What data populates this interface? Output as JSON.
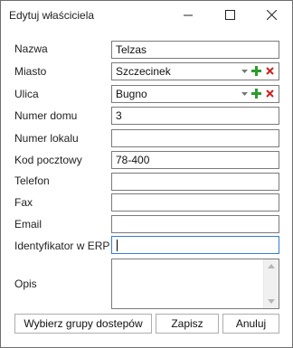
{
  "window": {
    "title": "Edytuj właściciela"
  },
  "fields": {
    "nazwa": {
      "label": "Nazwa",
      "value": "Telzas"
    },
    "miasto": {
      "label": "Miasto",
      "value": "Szczecinek"
    },
    "ulica": {
      "label": "Ulica",
      "value": "Bugno"
    },
    "numer_domu": {
      "label": "Numer domu",
      "value": "3"
    },
    "numer_lokalu": {
      "label": "Numer lokalu",
      "value": ""
    },
    "kod_pocztowy": {
      "label": "Kod pocztowy",
      "value": "78-400"
    },
    "telefon": {
      "label": "Telefon",
      "value": ""
    },
    "fax": {
      "label": "Fax",
      "value": ""
    },
    "email": {
      "label": "Email",
      "value": ""
    },
    "identyfikator_erp": {
      "label": "Identyfikator w ERP",
      "value": ""
    },
    "opis": {
      "label": "Opis",
      "value": ""
    }
  },
  "buttons": {
    "groups": "Wybierz grupy dostepów",
    "save": "Zapisz",
    "cancel": "Anuluj"
  },
  "icons": {
    "minimize": "minimize-icon",
    "maximize": "maximize-icon",
    "close": "close-icon",
    "dropdown": "chevron-down-icon",
    "add": "plus-icon",
    "remove": "x-icon"
  },
  "colors": {
    "add_green": "#2e9b2e",
    "remove_red": "#d02020"
  }
}
